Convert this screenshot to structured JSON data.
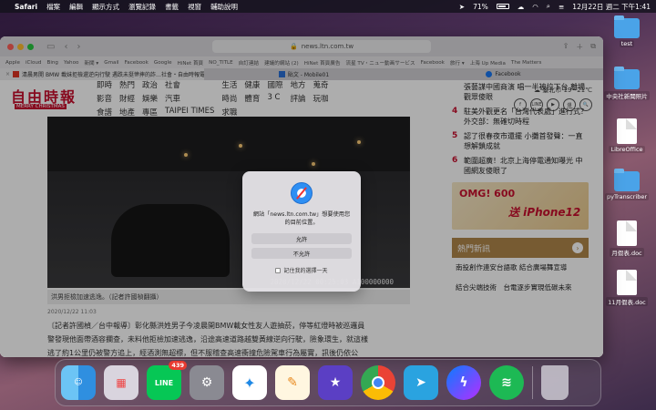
{
  "menubar": {
    "app": "Safari",
    "items": [
      "檔案",
      "編輯",
      "顯示方式",
      "瀏覽記錄",
      "書籤",
      "視窗",
      "輔助說明"
    ],
    "battery": "71%",
    "datetime": "12月22日 週二 下午1:41"
  },
  "desktop": [
    {
      "label": "test",
      "kind": "folder"
    },
    {
      "label": "中央社新聞照片",
      "kind": "folder"
    },
    {
      "label": "LibreOffice",
      "kind": "doc"
    },
    {
      "label": "pyTranscriber",
      "kind": "folder"
    },
    {
      "label": "月假表.doc",
      "kind": "doc"
    },
    {
      "label": "11月假表.doc",
      "kind": "doc"
    }
  ],
  "browser": {
    "url": "news.ltn.com.tw",
    "favorites": [
      "Apple",
      "iCloud",
      "Bing",
      "Yahoo",
      "新聞 ▾",
      "Gmail",
      "Facebook",
      "Google",
      "HiNet 首頁",
      "NO_TITLE",
      "自訂連結",
      "建議的網站 (2)",
      "HiNet 首頁廣告",
      "流星 TV・ニュー動画サービス",
      "Facebook",
      "旅行 ▾",
      "上海 Up Media",
      "The Matters"
    ],
    "tabs": [
      {
        "title": "清晨男開 BMW 載妹拒檢還逆向行駛 遇跌未挺慘摔的詐…社會・自由時報電子報",
        "active": true
      },
      {
        "title": "貼文 - Mobile01",
        "active": false
      },
      {
        "title": "Facebook",
        "active": false
      }
    ]
  },
  "site": {
    "logo": "自由時報",
    "logo_sub": "MERRY CHRISTMAS",
    "nav": [
      "即時",
      "熱門",
      "政治",
      "社會",
      "生活",
      "健康",
      "國際",
      "地方",
      "蒐奇",
      "影音",
      "財經",
      "娛樂",
      "汽車",
      "時尚",
      "體育",
      "3 C",
      "評論",
      "玩咖",
      "食譜",
      "地產",
      "專區",
      "TAIPEI TIMES",
      "求職"
    ],
    "weather": "臺北市 19~21℃",
    "social": [
      "f",
      "LINE",
      "▶",
      "爆",
      "🔍"
    ]
  },
  "article": {
    "video_stamp": "2020/12/22 00:25:03   A100000000",
    "caption": "洪男拒檢加速逃逸。（記者許國楨翻攝）",
    "date": "2020/12/22 11:03",
    "body_line1": "〔記者許國楨／台中報導〕彰化縣洪姓男子今凌晨開BMW載女性友人遊抽菸，停等紅燈時被巡邏員",
    "body_line2": "警發現他面帶酒容攔查，未料他拒檢加速逃逸，沿途高速道路越雙黃線逆向行駛，險象環生，就這樣",
    "body_line3": "逃了約1公里仍被警方追上，經酒測無超標，但不服稽查高速衝撞危險駕車行為屬實，訊後仍依公"
  },
  "sidebar": {
    "news": [
      {
        "n": "",
        "text": "張藝謀中國商演 唱一半被拉下台 離場 觀眾傻眼"
      },
      {
        "n": "4",
        "text": "駐美外觀更名「台灣代表處」進行式？外交部：無確切時程"
      },
      {
        "n": "5",
        "text": "認了很春夜市還擺 小攤首發聲：一直想解鎖成就"
      },
      {
        "n": "6",
        "text": "範圍超廣！北京上海停電通知曝光 中國網友傻眼了"
      }
    ],
    "ad_text_1": "OMG! 600",
    "ad_text_2": "送 iPhone12",
    "hot_title": "熱門新訊",
    "hot_items": [
      "南投創作連安台語歌 結合廣場舞宣導",
      "結合尖端技術　台電逐步實現低碳未來"
    ]
  },
  "dialog": {
    "message": "網站「news.ltn.com.tw」想要使用您的目前位置。",
    "allow": "允許",
    "deny": "不允許",
    "remember": "記住我的選擇一天"
  },
  "dock": {
    "line_badge": "439",
    "apps": [
      "finder-icon",
      "launchpad-icon",
      "line-icon",
      "system-preferences-icon",
      "safari-icon",
      "pages-icon",
      "imovie-icon",
      "chrome-icon",
      "telegram-icon",
      "messenger-icon",
      "spotify-icon",
      "trash-icon"
    ]
  }
}
